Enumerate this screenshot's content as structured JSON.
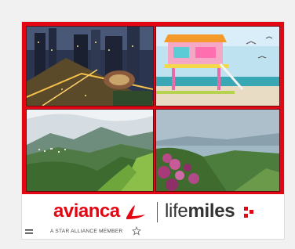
{
  "ad": {
    "brand": "avianca",
    "partner": {
      "prefix": "life",
      "suffix": "miles"
    },
    "tagline": "A STAR ALLIANCE MEMBER",
    "colors": {
      "brand_red": "#e30613",
      "text_dark": "#333333",
      "background": "#f1f1f1"
    },
    "icons": [
      "menu-icon",
      "star-alliance-icon",
      "avianca-wing-icon",
      "lifemiles-dots-icon"
    ],
    "photos": [
      {
        "name": "city-aerial-night"
      },
      {
        "name": "beach-lifeguard-tower"
      },
      {
        "name": "green-mountain-valley"
      },
      {
        "name": "lake-hills-flowers"
      }
    ]
  }
}
